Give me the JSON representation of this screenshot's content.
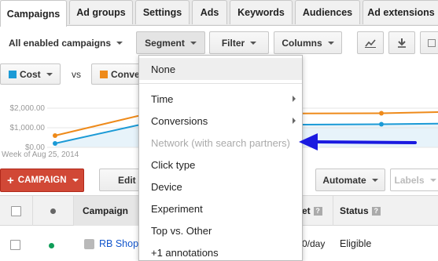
{
  "tabs": [
    "Campaigns",
    "Ad groups",
    "Settings",
    "Ads",
    "Keywords",
    "Audiences",
    "Ad extensions"
  ],
  "toolbar": {
    "filter_label": "All enabled campaigns",
    "segment_label": "Segment",
    "filter_btn_label": "Filter",
    "columns_label": "Columns"
  },
  "metrics": {
    "metric1": "Cost",
    "vs": "vs",
    "metric2": "Conve",
    "metric1_color": "#1b9ad6",
    "metric2_color": "#ee8a1a"
  },
  "chart_data": {
    "type": "line",
    "yticks": [
      "$2,000.00",
      "$1,000.00",
      "$0.00"
    ],
    "xlabel": "Week of Aug 25, 2014",
    "series": [
      {
        "name": "Cost",
        "color": "#1b9ad6",
        "values": [
          200,
          1130,
          1140,
          1150,
          1160,
          1180,
          1210
        ]
      },
      {
        "name": "Conve",
        "color": "#ee8a1a",
        "values": [
          600,
          1600,
          1700,
          1720,
          1730,
          1740,
          1800
        ]
      }
    ],
    "ylim": [
      0,
      2400
    ]
  },
  "actions": {
    "campaign_label": "CAMPAIGN",
    "edit_label": "Edit",
    "automate_label": "Automate",
    "labels_label": "Labels"
  },
  "table": {
    "col_campaign": "Campaign",
    "col_budget": "et",
    "col_status": "Status",
    "row1": {
      "campaign": "RB Shop",
      "budget": "0/day",
      "status": "Eligible",
      "status_color": "#0f9d58"
    }
  },
  "segment_menu": {
    "items": [
      {
        "label": "None",
        "selected": true
      },
      {
        "label": "Time",
        "submenu": true
      },
      {
        "label": "Conversions",
        "submenu": true
      },
      {
        "label": "Network (with search partners)",
        "disabled": true
      },
      {
        "label": "Click type"
      },
      {
        "label": "Device"
      },
      {
        "label": "Experiment"
      },
      {
        "label": "Top vs. Other"
      },
      {
        "label": "+1 annotations"
      }
    ]
  },
  "annotation_arrow_color": "#1a1ae0"
}
